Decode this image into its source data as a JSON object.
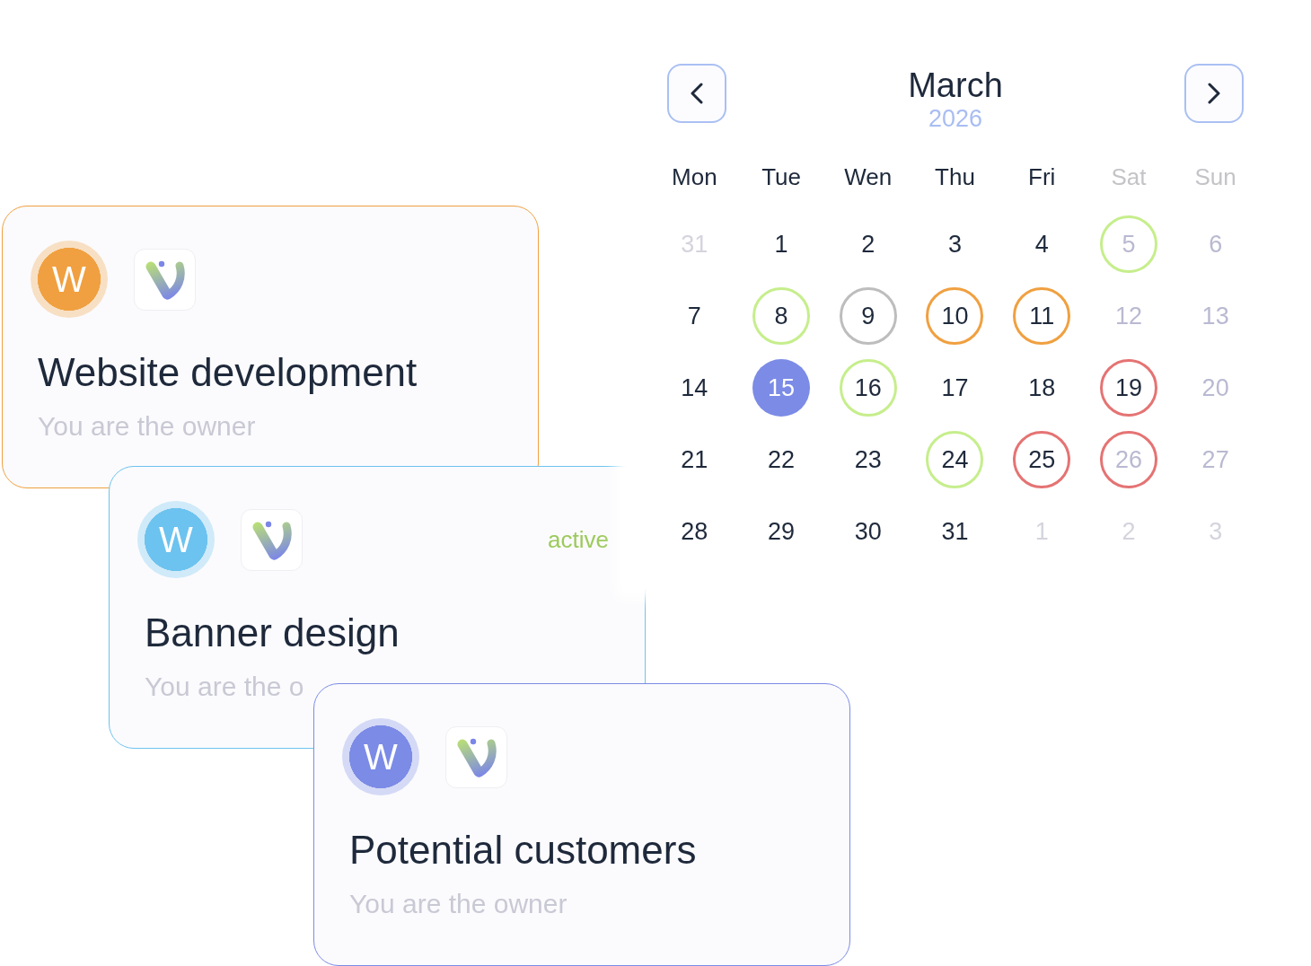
{
  "cards": [
    {
      "avatar": "W",
      "color": "#f0a040",
      "title": "Website development",
      "subtitle": "You are the owner"
    },
    {
      "avatar": "W",
      "color": "#6cc3ef",
      "status": "active",
      "title": "Banner design",
      "subtitle": "You are the o"
    },
    {
      "avatar": "W",
      "color": "#7b8be6",
      "title": "Potential customers",
      "subtitle": "You are the owner"
    }
  ],
  "calendar": {
    "month": "March",
    "year": "2026",
    "weekdays": [
      {
        "label": "Mon",
        "weekend": false
      },
      {
        "label": "Tue",
        "weekend": false
      },
      {
        "label": "Wen",
        "weekend": false
      },
      {
        "label": "Thu",
        "weekend": false
      },
      {
        "label": "Fri",
        "weekend": false
      },
      {
        "label": "Sat",
        "weekend": true
      },
      {
        "label": "Sun",
        "weekend": true
      }
    ],
    "days": [
      {
        "day": "31",
        "kind": "other",
        "selected": false
      },
      {
        "day": "1",
        "kind": "day",
        "selected": false
      },
      {
        "day": "2",
        "kind": "day",
        "selected": false
      },
      {
        "day": "3",
        "kind": "day",
        "selected": false
      },
      {
        "day": "4",
        "kind": "day",
        "selected": false
      },
      {
        "day": "5",
        "kind": "weekend",
        "selected": false,
        "color": "#c6ee8c"
      },
      {
        "day": "6",
        "kind": "weekend",
        "selected": false
      },
      {
        "day": "7",
        "kind": "day",
        "selected": false
      },
      {
        "day": "8",
        "kind": "day",
        "selected": false,
        "color": "#c6ee8c"
      },
      {
        "day": "9",
        "kind": "day",
        "selected": false,
        "color": "#bdbdbd"
      },
      {
        "day": "10",
        "kind": "day",
        "selected": false,
        "color": "#f0a040"
      },
      {
        "day": "11",
        "kind": "day",
        "selected": false,
        "color": "#f0a040"
      },
      {
        "day": "12",
        "kind": "weekend",
        "selected": false
      },
      {
        "day": "13",
        "kind": "weekend",
        "selected": false
      },
      {
        "day": "14",
        "kind": "day",
        "selected": false
      },
      {
        "day": "15",
        "kind": "day",
        "selected": true
      },
      {
        "day": "16",
        "kind": "day",
        "selected": false,
        "color": "#c6ee8c"
      },
      {
        "day": "17",
        "kind": "day",
        "selected": false
      },
      {
        "day": "18",
        "kind": "day",
        "selected": false
      },
      {
        "day": "19",
        "kind": "day",
        "selected": false,
        "color": "#e57373"
      },
      {
        "day": "20",
        "kind": "weekend",
        "selected": false
      },
      {
        "day": "21",
        "kind": "day",
        "selected": false
      },
      {
        "day": "22",
        "kind": "day",
        "selected": false
      },
      {
        "day": "23",
        "kind": "day",
        "selected": false
      },
      {
        "day": "24",
        "kind": "day",
        "selected": false,
        "color": "#c6ee8c"
      },
      {
        "day": "25",
        "kind": "day",
        "selected": false,
        "color": "#e57373"
      },
      {
        "day": "26",
        "kind": "weekend",
        "selected": false,
        "color": "#e57373"
      },
      {
        "day": "27",
        "kind": "weekend",
        "selected": false
      },
      {
        "day": "28",
        "kind": "day",
        "selected": false
      },
      {
        "day": "29",
        "kind": "day",
        "selected": false
      },
      {
        "day": "30",
        "kind": "day",
        "selected": false
      },
      {
        "day": "31",
        "kind": "day",
        "selected": false
      },
      {
        "day": "1",
        "kind": "other",
        "selected": false
      },
      {
        "day": "2",
        "kind": "other",
        "selected": false
      },
      {
        "day": "3",
        "kind": "other",
        "selected": false
      }
    ]
  }
}
